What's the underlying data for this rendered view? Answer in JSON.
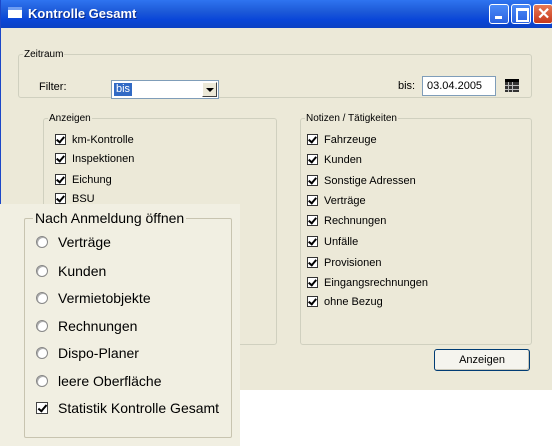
{
  "window": {
    "title": "Kontrolle Gesamt"
  },
  "zeitraum": {
    "legend": "Zeitraum",
    "filter_label": "Filter:",
    "filter_value": "bis",
    "bis_label": "bis:",
    "date_value": "03.04.2005"
  },
  "anzeigen_group": {
    "legend": "Anzeigen",
    "items": [
      "km-Kontrolle",
      "Inspektionen",
      "Eichung",
      "BSU"
    ]
  },
  "notizen_group": {
    "legend": "Notizen / Tätigkeiten",
    "items": [
      "Fahrzeuge",
      "Kunden",
      "Sonstige Adressen",
      "Verträge",
      "Rechnungen",
      "Unfälle",
      "Provisionen",
      "Eingangsrechnungen",
      "ohne Bezug"
    ]
  },
  "anzeigen_button": "Anzeigen",
  "startup_panel": {
    "legend": "Nach Anmeldung öffnen",
    "options": [
      "Verträge",
      "Kunden",
      "Vermietobjekte",
      "Rechnungen",
      "Dispo-Planer",
      "leere Oberfläche"
    ],
    "checkbox_label": "Statistik Kontrolle Gesamt"
  },
  "colors": {
    "titlebar": "#0a46d8",
    "window_bg": "#ece9d8",
    "selection": "#316ac5"
  }
}
